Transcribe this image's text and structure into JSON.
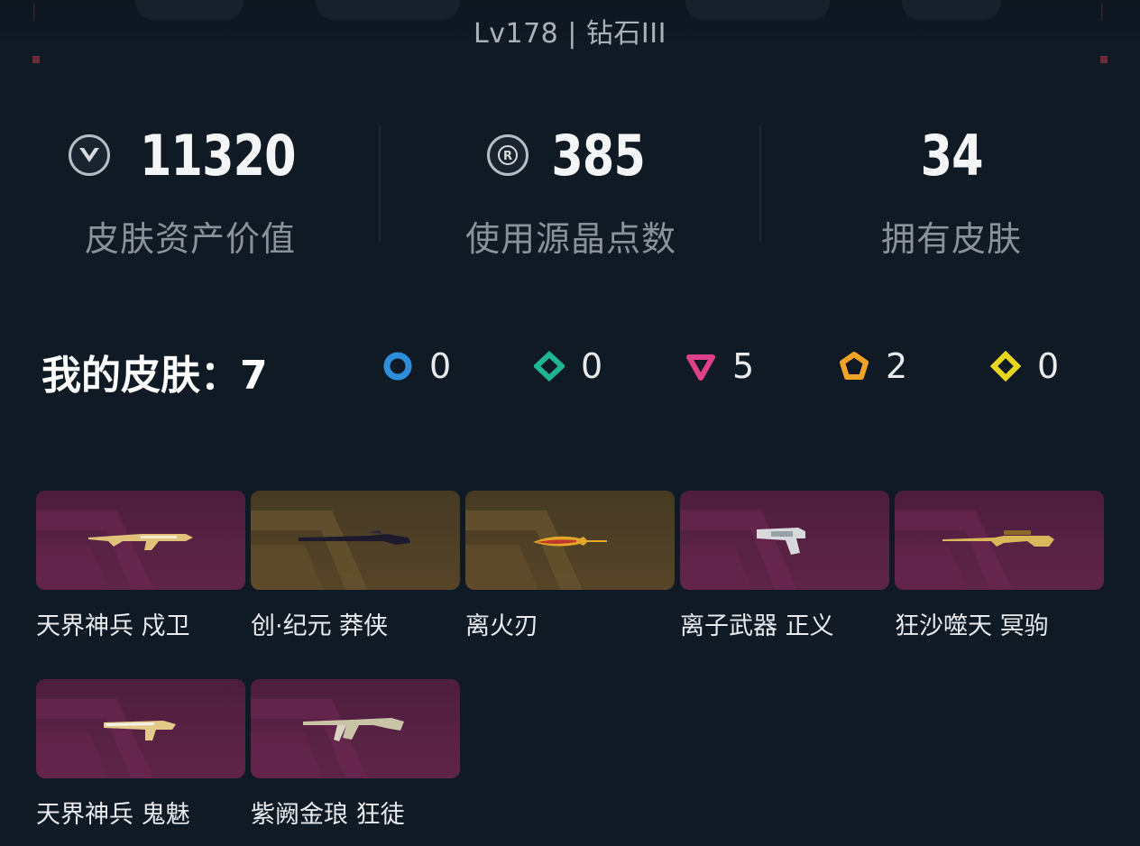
{
  "header": {
    "level_text": "Lv178 | 钻石III"
  },
  "stats": [
    {
      "icon": "valorant-points-icon",
      "value": "11320",
      "label": "皮肤资产价值"
    },
    {
      "icon": "radianite-icon",
      "value": "385",
      "label": "使用源晶点数"
    },
    {
      "icon": "",
      "value": "34",
      "label": "拥有皮肤"
    }
  ],
  "skins_summary": {
    "title": "我的皮肤：7",
    "tiers": [
      {
        "icon": "select-tier-icon",
        "color": "#2d8fd9",
        "count": "0"
      },
      {
        "icon": "deluxe-tier-icon",
        "color": "#1fb492",
        "count": "0"
      },
      {
        "icon": "premium-tier-icon",
        "color": "#e0408a",
        "count": "5"
      },
      {
        "icon": "ultra-tier-icon",
        "color": "#f0a324",
        "count": "2"
      },
      {
        "icon": "exclusive-tier-icon",
        "color": "#e6d71e",
        "count": "0"
      }
    ]
  },
  "skins": [
    {
      "name": "天界神兵 戍卫",
      "tier_color": "#5a2246",
      "weapon": "rifle-icon"
    },
    {
      "name": "创·纪元 莽侠",
      "tier_color": "#524226",
      "weapon": "shotgun-icon"
    },
    {
      "name": "离火刃",
      "tier_color": "#524226",
      "weapon": "knife-icon"
    },
    {
      "name": "离子武器 正义",
      "tier_color": "#5a2246",
      "weapon": "revolver-icon"
    },
    {
      "name": "狂沙噬天 冥驹",
      "tier_color": "#5a2246",
      "weapon": "sniper-icon"
    },
    {
      "name": "天界神兵 鬼魅",
      "tier_color": "#5a2246",
      "weapon": "pistol-icon"
    },
    {
      "name": "紫阙金琅 狂徒",
      "tier_color": "#5a2246",
      "weapon": "rifle-icon"
    }
  ]
}
